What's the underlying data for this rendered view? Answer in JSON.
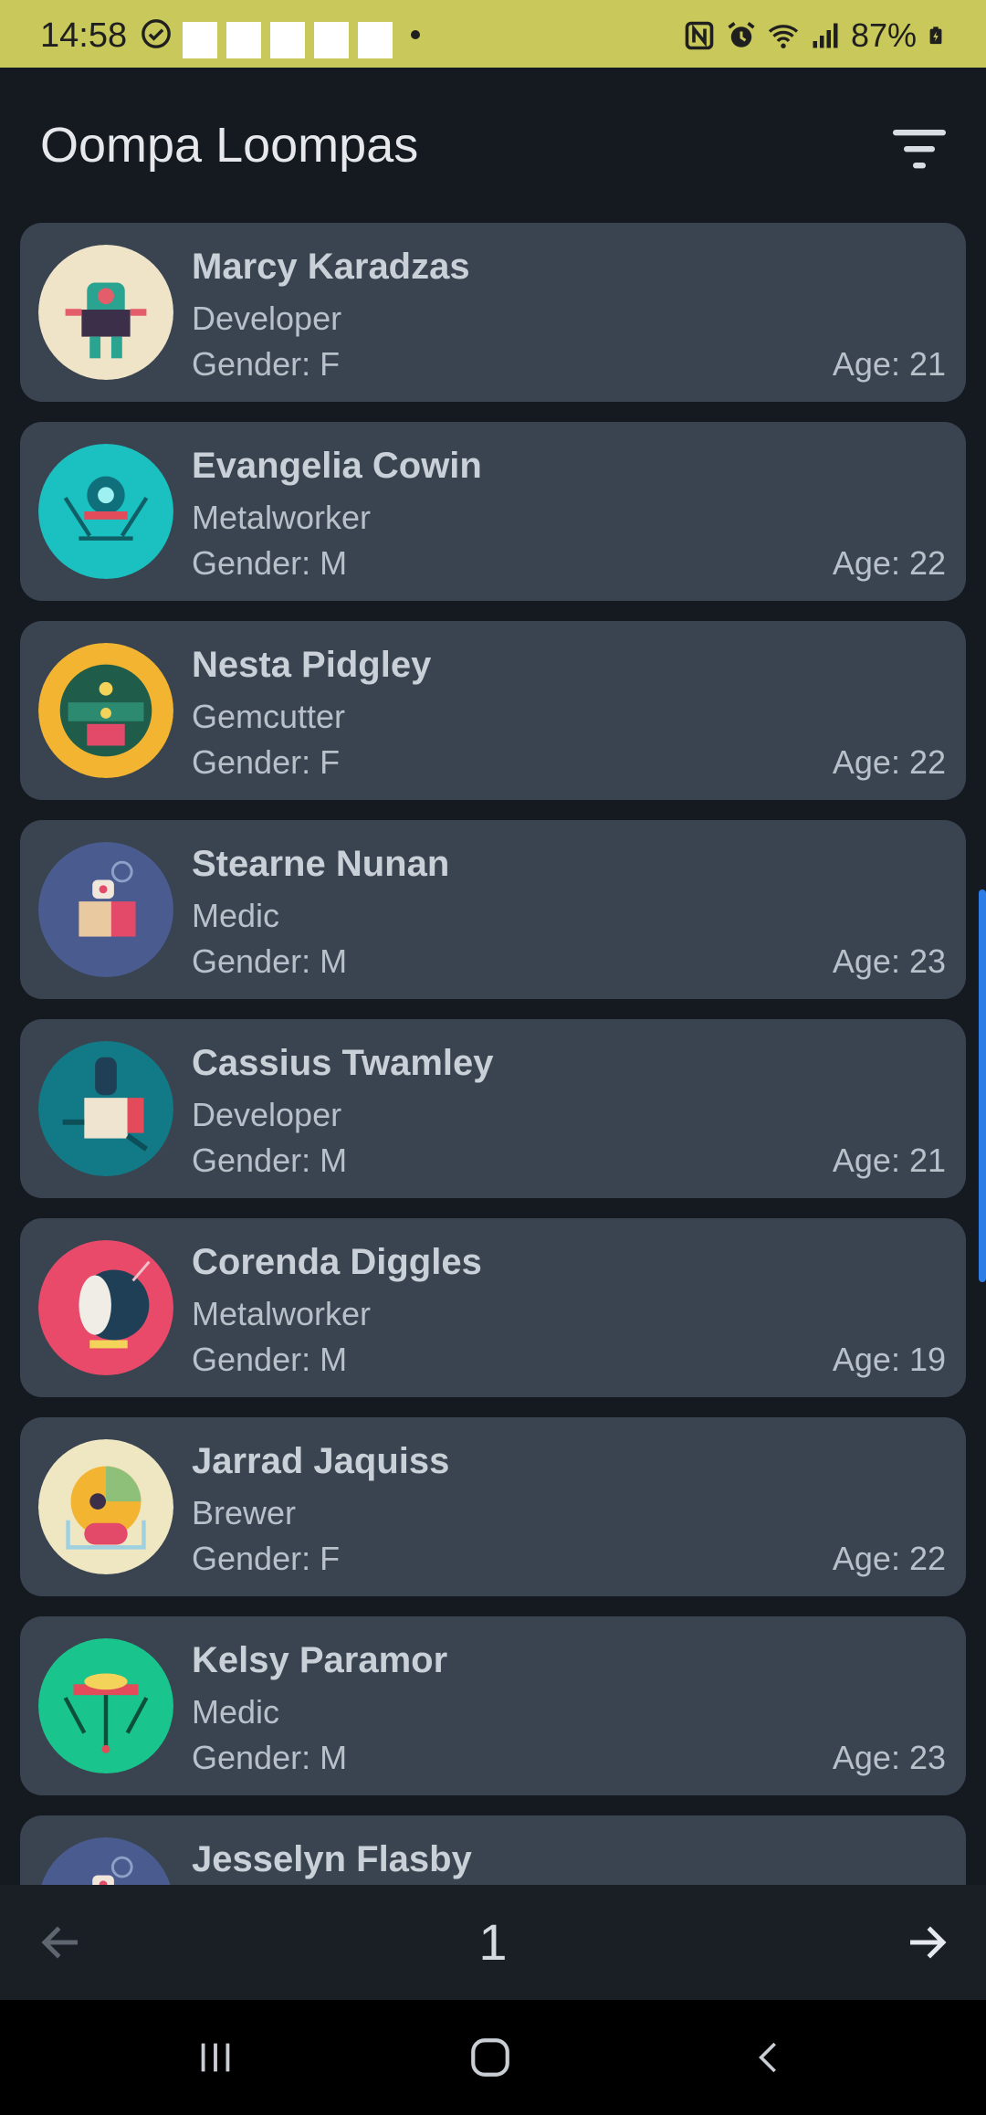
{
  "status_bar": {
    "time": "14:58",
    "battery": "87%",
    "icons": [
      "check-circle-icon",
      "notification-placeholder",
      "nfc-icon",
      "alarm-icon",
      "wifi-icon",
      "signal-icon",
      "battery-icon"
    ]
  },
  "app_bar": {
    "title": "Oompa Loompas",
    "filter_icon": "filter-icon"
  },
  "colors": {
    "status_bar_bg": "#c9c85a",
    "app_bg": "#151a21",
    "card_bg": "#3a4450",
    "scroll_accent": "#2d7de6"
  },
  "list": {
    "items": [
      {
        "name": "Marcy Karadzas",
        "job": "Developer",
        "gender": "Gender: F",
        "age": "Age: 21",
        "avatar_bg": "#efe4c8",
        "avatar_icon": "robot-avatar-icon"
      },
      {
        "name": "Evangelia Cowin",
        "job": "Metalworker",
        "gender": "Gender: M",
        "age": "Age: 22",
        "avatar_bg": "#1bc0c0",
        "avatar_icon": "robot-avatar-icon"
      },
      {
        "name": "Nesta Pidgley",
        "job": "Gemcutter",
        "gender": "Gender: F",
        "age": "Age: 22",
        "avatar_bg": "#f3b531",
        "avatar_icon": "robot-avatar-icon"
      },
      {
        "name": "Stearne Nunan",
        "job": "Medic",
        "gender": "Gender: M",
        "age": "Age: 23",
        "avatar_bg": "#4a5b8f",
        "avatar_icon": "robot-avatar-icon"
      },
      {
        "name": "Cassius Twamley",
        "job": "Developer",
        "gender": "Gender: M",
        "age": "Age: 21",
        "avatar_bg": "#127a86",
        "avatar_icon": "robot-avatar-icon"
      },
      {
        "name": "Corenda Diggles",
        "job": "Metalworker",
        "gender": "Gender: M",
        "age": "Age: 19",
        "avatar_bg": "#ea4a6a",
        "avatar_icon": "robot-avatar-icon"
      },
      {
        "name": "Jarrad Jaquiss",
        "job": "Brewer",
        "gender": "Gender: F",
        "age": "Age: 22",
        "avatar_bg": "#efe6c2",
        "avatar_icon": "robot-avatar-icon"
      },
      {
        "name": "Kelsy Paramor",
        "job": "Medic",
        "gender": "Gender: M",
        "age": "Age: 23",
        "avatar_bg": "#19c58c",
        "avatar_icon": "robot-avatar-icon"
      },
      {
        "name": "Jesselyn Flasby",
        "job": "",
        "gender": "",
        "age": "",
        "avatar_bg": "#4a5b8f",
        "avatar_icon": "robot-avatar-icon"
      }
    ]
  },
  "pagination": {
    "page": "1",
    "prev_icon": "arrow-left-icon",
    "next_icon": "arrow-right-icon"
  },
  "nav_bar": {
    "icons": [
      "recents-icon",
      "home-icon",
      "back-icon"
    ]
  }
}
